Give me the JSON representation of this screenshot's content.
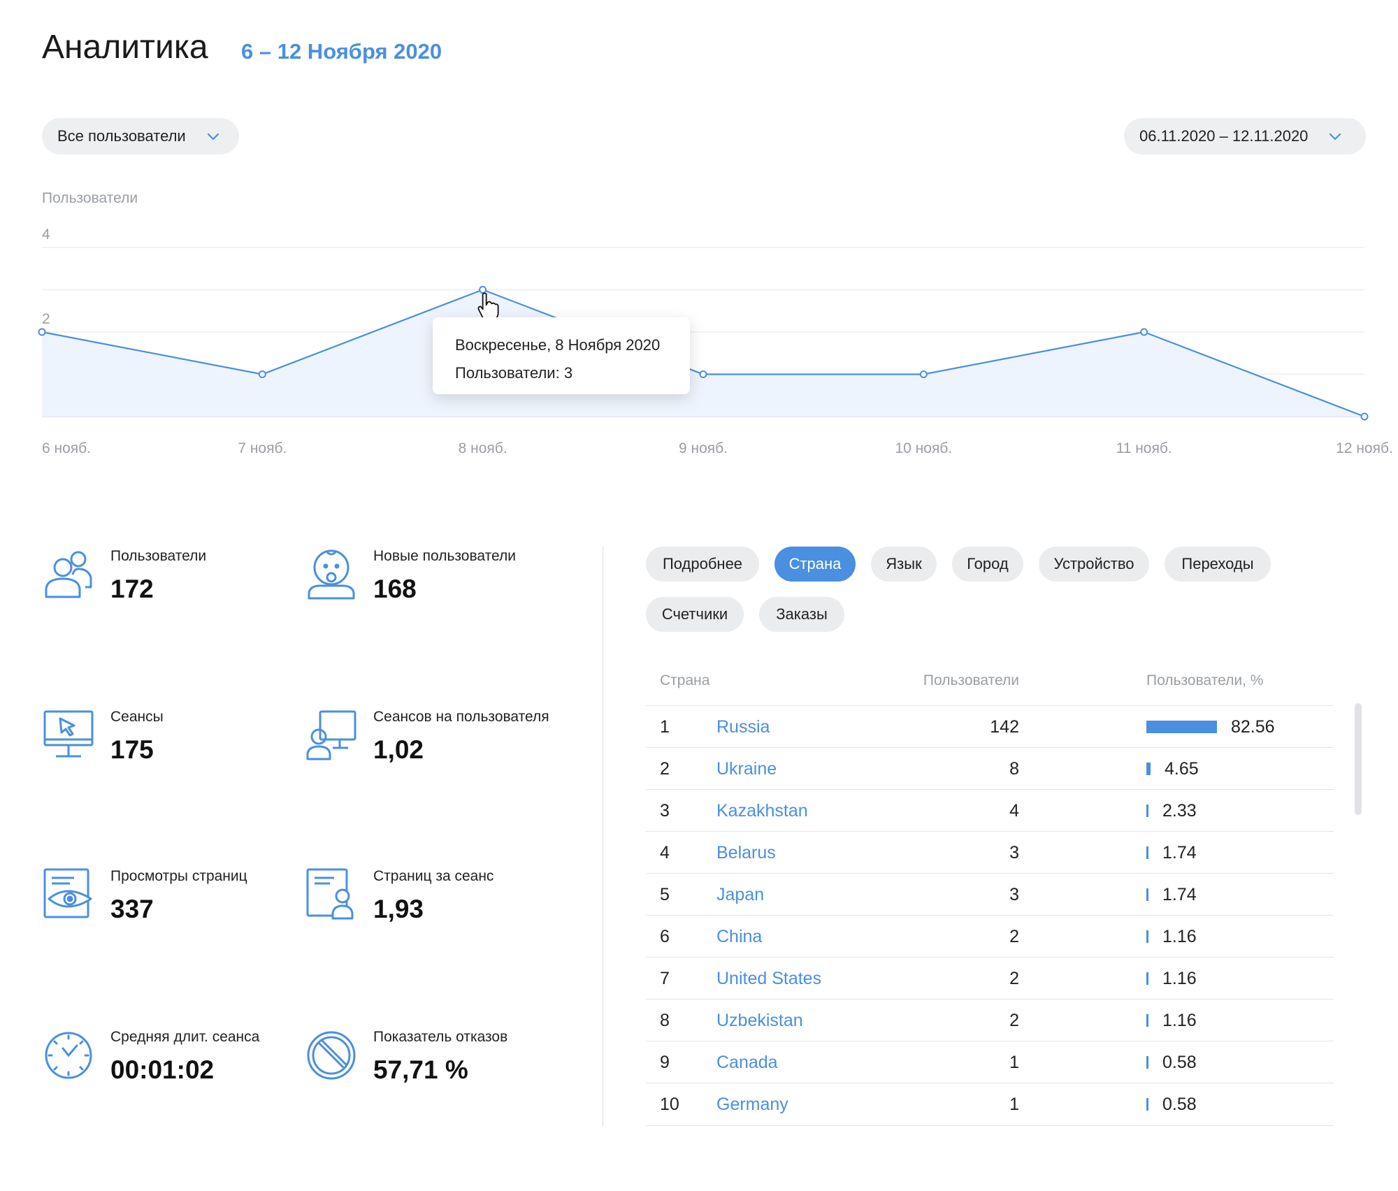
{
  "header": {
    "title": "Аналитика",
    "date_range": "6 – 12 Ноября 2020"
  },
  "filters": {
    "audience": {
      "value": "Все пользователи",
      "icon": "chevron-down-icon"
    },
    "period": {
      "value": "06.11.2020 – 12.11.2020",
      "icon": "chevron-down-icon"
    }
  },
  "chart_data": {
    "type": "area",
    "ylabel": "Пользователи",
    "xlabel": "",
    "categories": [
      "6 нояб.",
      "7 нояб.",
      "8 нояб.",
      "9 нояб.",
      "10 нояб.",
      "11 нояб.",
      "12 нояб."
    ],
    "values": [
      2,
      1,
      3,
      1,
      1,
      2,
      0
    ],
    "ylim": [
      0,
      4
    ],
    "yticks": [
      "4",
      "2"
    ],
    "grid": true,
    "line_color": "#4a8fe0",
    "fill_color": "#edf4fd"
  },
  "tooltip": {
    "date": "Воскресенье, 8 Ноября 2020",
    "value": "Пользователи: 3"
  },
  "metrics": [
    {
      "label": "Пользователи",
      "value": "172",
      "icon": "users-icon"
    },
    {
      "label": "Новые пользователи",
      "value": "168",
      "icon": "baby-icon"
    },
    {
      "label": "Сеансы",
      "value": "175",
      "icon": "monitor-cursor-icon"
    },
    {
      "label": "Сеансов на пользователя",
      "value": "1,02",
      "icon": "user-monitor-icon"
    },
    {
      "label": "Просмотры страниц",
      "value": "337",
      "icon": "page-view-icon"
    },
    {
      "label": "Страниц за сеанс",
      "value": "1,93",
      "icon": "page-user-icon"
    },
    {
      "label": "Средняя длит. сеанса",
      "value": "00:01:02",
      "icon": "clock-icon"
    },
    {
      "label": "Показатель отказов",
      "value": "57,71 %",
      "icon": "ban-icon"
    }
  ],
  "tabs": [
    {
      "label": "Подробнее",
      "active": false
    },
    {
      "label": "Страна",
      "active": true
    },
    {
      "label": "Язык",
      "active": false
    },
    {
      "label": "Город",
      "active": false
    },
    {
      "label": "Устройство",
      "active": false
    },
    {
      "label": "Переходы",
      "active": false
    },
    {
      "label": "Счетчики",
      "active": false
    },
    {
      "label": "Заказы",
      "active": false
    }
  ],
  "table": {
    "headers": {
      "country": "Страна",
      "users": "Пользователи",
      "percent": "Пользователи, %"
    },
    "rows": [
      {
        "rank": "1",
        "country": "Russia",
        "users": "142",
        "percent": "82.56",
        "share": 82.56
      },
      {
        "rank": "2",
        "country": "Ukraine",
        "users": "8",
        "percent": "4.65",
        "share": 4.65
      },
      {
        "rank": "3",
        "country": "Kazakhstan",
        "users": "4",
        "percent": "2.33",
        "share": 2.33
      },
      {
        "rank": "4",
        "country": "Belarus",
        "users": "3",
        "percent": "1.74",
        "share": 1.74
      },
      {
        "rank": "5",
        "country": "Japan",
        "users": "3",
        "percent": "1.74",
        "share": 1.74
      },
      {
        "rank": "6",
        "country": "China",
        "users": "2",
        "percent": "1.16",
        "share": 1.16
      },
      {
        "rank": "7",
        "country": "United States",
        "users": "2",
        "percent": "1.16",
        "share": 1.16
      },
      {
        "rank": "8",
        "country": "Uzbekistan",
        "users": "2",
        "percent": "1.16",
        "share": 1.16
      },
      {
        "rank": "9",
        "country": "Canada",
        "users": "1",
        "percent": "0.58",
        "share": 0.58
      },
      {
        "rank": "10",
        "country": "Germany",
        "users": "1",
        "percent": "0.58",
        "share": 0.58
      }
    ]
  },
  "colors": {
    "accent": "#4a8fe0",
    "muted": "#9a9ea4",
    "pill": "#ebecee"
  }
}
